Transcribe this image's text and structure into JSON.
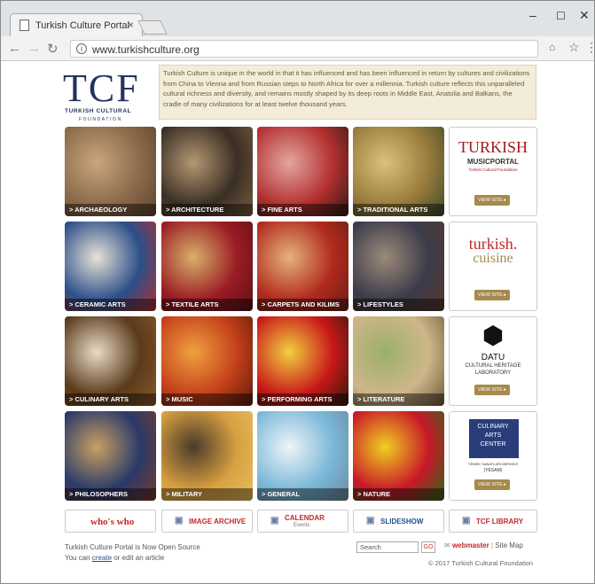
{
  "browser": {
    "tab_title": "Turkish Culture Portal",
    "tab_close": "×",
    "url": "www.turkishculture.org",
    "minimize": "–",
    "maximize": "☐",
    "close": "✕"
  },
  "logo": {
    "letters": "TCF",
    "line1": "TURKISH CULTURAL",
    "line2": "FOUNDATION"
  },
  "intro": "Turkish Culture is unique in the world in that it has influenced and has been influenced in return by cultures and civilizations from China to Vienna and from Russian steps to North Africa for over a millennia. Turkish culture reflects this unparalleled cultural richness and diversity, and remains mostly shaped by its deep roots in Middle East, Anatolia and Balkans, the cradle of many civilizations for at least twelve thousand years.",
  "tiles": [
    {
      "label": "ARCHAEOLOGY",
      "colors": [
        "#8b6a4a",
        "#c9a67c",
        "#5e4330"
      ]
    },
    {
      "label": "ARCHITECTURE",
      "colors": [
        "#3a2f25",
        "#b59772",
        "#7a5c3d"
      ]
    },
    {
      "label": "FINE ARTS",
      "colors": [
        "#b33030",
        "#e3a6a0",
        "#2d1a14"
      ]
    },
    {
      "label": "TRADITIONAL ARTS",
      "colors": [
        "#9a7b3c",
        "#d9c27a",
        "#3b4a2a"
      ]
    },
    {
      "label": "CERAMIC ARTS",
      "colors": [
        "#2c4f8a",
        "#e8e2d6",
        "#b22f2f"
      ]
    },
    {
      "label": "TEXTILE ARTS",
      "colors": [
        "#9b1c24",
        "#d8b06a",
        "#5c0f14"
      ]
    },
    {
      "label": "CARPETS AND KILIMS",
      "colors": [
        "#b12a1e",
        "#e4b37a",
        "#6a1c14"
      ]
    },
    {
      "label": "LIFESTYLES",
      "colors": [
        "#3b3b4a",
        "#9c8a7a",
        "#5a3a2a"
      ]
    },
    {
      "label": "CULINARY ARTS",
      "colors": [
        "#5a3a1a",
        "#e8dcc8",
        "#8b5a2b"
      ]
    },
    {
      "label": "MUSIC",
      "colors": [
        "#c4401a",
        "#f0a040",
        "#5a1a0a"
      ]
    },
    {
      "label": "PERFORMING ARTS",
      "colors": [
        "#c81818",
        "#f2d040",
        "#2a1a0a"
      ]
    },
    {
      "label": "LITERATURE",
      "colors": [
        "#cfb68a",
        "#9bb06a",
        "#6a5a3a"
      ]
    },
    {
      "label": "PHILOSOPHERS",
      "colors": [
        "#2a3a6a",
        "#c9a060",
        "#7a3a2a"
      ]
    },
    {
      "label": "MILITARY",
      "colors": [
        "#d8a040",
        "#4a3a2a",
        "#e8c060"
      ]
    },
    {
      "label": "GENERAL",
      "colors": [
        "#7ab8d8",
        "#f0f4f8",
        "#6a8aa0"
      ]
    },
    {
      "label": "NATURE",
      "colors": [
        "#c81828",
        "#f0d020",
        "#2a6a1a"
      ]
    }
  ],
  "sidebar": [
    {
      "title1": "TURKISH",
      "title2": "MUSICPORTAL",
      "sub": "Turkish Cultural Foundation",
      "button": "VIEW SITE ▸"
    },
    {
      "title1": "turkish.",
      "title2": "cuisine",
      "button": "VIEW SITE ▸"
    },
    {
      "title1": "DATU",
      "title2": "CULTURAL HERITAGE",
      "title3": "LABORATORY",
      "button": "VIEW SITE ▸"
    },
    {
      "title1": "CULINARY",
      "title2": "ARTS",
      "title3": "CENTER",
      "sub": "YEMEK SANATLARI MERKEZİ",
      "sub2": "(YESAM)",
      "button": "VIEW SITE ▸"
    }
  ],
  "bottom_links": [
    {
      "label": "who's who",
      "color": "#c0282b"
    },
    {
      "label": "IMAGE ARCHIVE",
      "color": "#c0282b"
    },
    {
      "label": "CALENDAR",
      "sub": "Events",
      "color": "#c0282b"
    },
    {
      "label": "SLIDESHOW",
      "color": "#1e4f94"
    },
    {
      "label": "TCF LIBRARY",
      "color": "#c0282b"
    }
  ],
  "footer": {
    "line1": "Turkish Culture Portal is Now Open Source",
    "line2_pre": "You can ",
    "line2_link": "create",
    "line2_post": " or edit an article",
    "search_placeholder": "Search",
    "go": "GO",
    "webmaster": "webmaster",
    "separator": "|",
    "sitemap": "Site Map",
    "copyright": "© 2017 Turkish Cultural Foundation"
  }
}
